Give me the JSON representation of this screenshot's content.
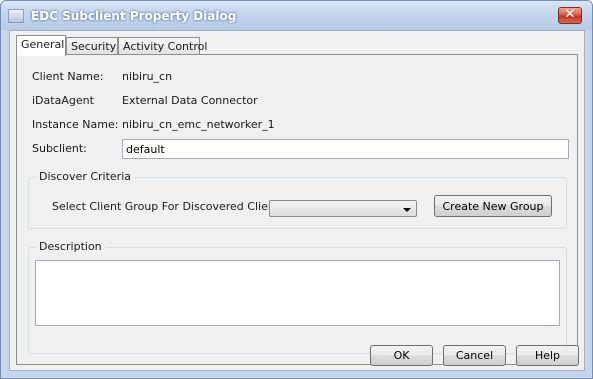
{
  "window": {
    "title": "EDC Subclient Property Dialog",
    "close_glyph": "✕"
  },
  "tabs": [
    {
      "label": "General",
      "active": true
    },
    {
      "label": "Security",
      "active": false
    },
    {
      "label": "Activity Control",
      "active": false
    }
  ],
  "general": {
    "client_name_label": "Client Name:",
    "client_name_value": "nibiru_cn",
    "idataagent_label": "iDataAgent",
    "idataagent_value": "External Data Connector",
    "instance_name_label": "Instance Name:",
    "instance_name_value": "nibiru_cn_emc_networker_1",
    "subclient_label": "Subclient:",
    "subclient_value": "default"
  },
  "discover_criteria": {
    "legend": "Discover Criteria",
    "client_group_label": "Select Client Group For Discovered Clients",
    "client_group_selected": "",
    "create_group_button": "Create New Group"
  },
  "description": {
    "legend": "Description",
    "value": ""
  },
  "footer": {
    "ok_label": "OK",
    "cancel_label": "Cancel",
    "help_label": "Help"
  }
}
